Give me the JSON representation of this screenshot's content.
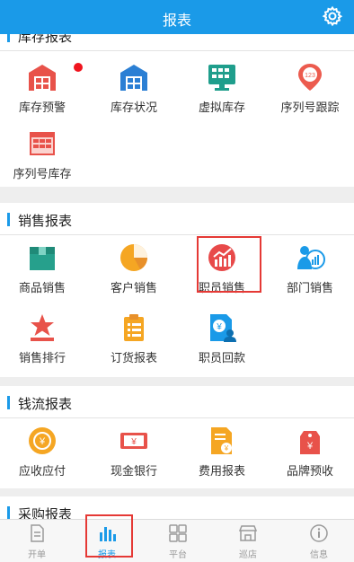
{
  "header": {
    "title": "报表"
  },
  "sections": {
    "inventory": {
      "title": "库存报表",
      "items": [
        "库存预警",
        "库存状况",
        "虚拟库存",
        "序列号跟踪",
        "序列号库存"
      ]
    },
    "sales": {
      "title": "销售报表",
      "items": [
        "商品销售",
        "客户销售",
        "职员销售",
        "部门销售",
        "销售排行",
        "订货报表",
        "职员回款"
      ]
    },
    "cashflow": {
      "title": "钱流报表",
      "items": [
        "应收应付",
        "现金银行",
        "费用报表",
        "品牌预收"
      ]
    },
    "purchase": {
      "title": "采购报表"
    }
  },
  "tabs": [
    "开单",
    "报表",
    "平台",
    "巡店",
    "信息"
  ],
  "colors": {
    "accent": "#1a9ae8",
    "highlight": "#e53935"
  },
  "icons": {
    "inventory": [
      "warehouse-alert-icon",
      "warehouse-status-icon",
      "monitor-grid-icon",
      "location-pin-123-icon",
      "serial-grid-icon"
    ],
    "sales": [
      "product-box-icon",
      "pie-chart-icon",
      "trend-chart-icon",
      "person-chart-icon",
      "star-podium-icon",
      "clipboard-list-icon",
      "yen-person-doc-icon"
    ],
    "cashflow": [
      "yen-cycle-icon",
      "yen-bill-icon",
      "yen-document-icon",
      "yen-tag-icon"
    ],
    "tabs": [
      "document-icon",
      "bar-chart-icon",
      "grid-squares-icon",
      "shop-icon",
      "info-icon"
    ]
  }
}
